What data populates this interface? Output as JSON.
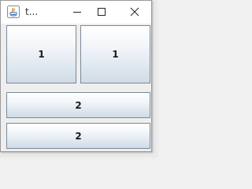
{
  "window": {
    "title": "t...",
    "app_icon": "java-icon"
  },
  "titlebar": {
    "minimize_icon": "minimize-icon",
    "maximize_icon": "maximize-icon",
    "close_icon": "close-icon"
  },
  "buttons": [
    {
      "label": "1"
    },
    {
      "label": "1"
    },
    {
      "label": "2"
    },
    {
      "label": "2"
    }
  ],
  "colors": {
    "button_border": "#7a8a99",
    "button_gradient_top": "#ffffff",
    "button_gradient_bottom": "#cfdbe7",
    "window_bg": "#f0f0f0"
  }
}
